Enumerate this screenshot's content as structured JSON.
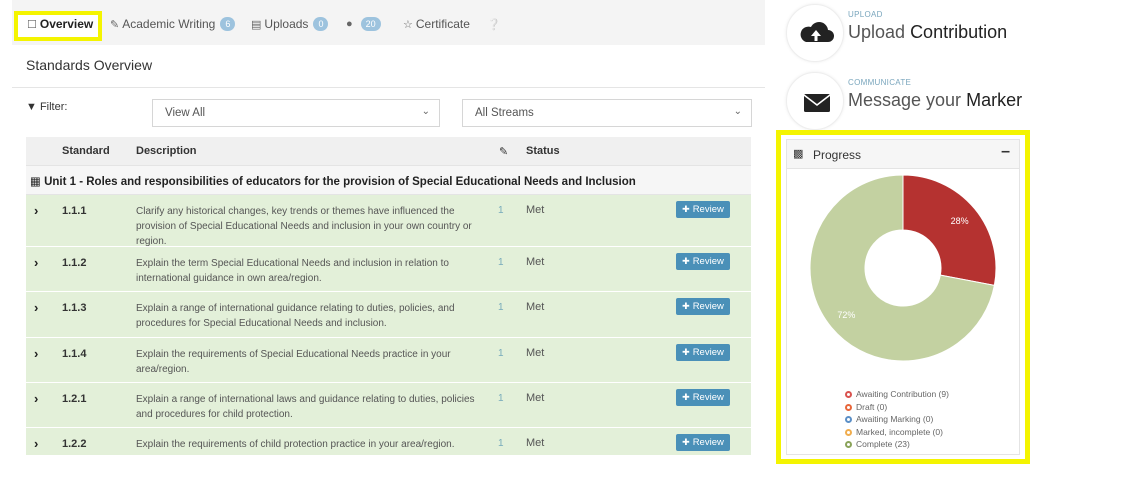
{
  "tabs": [
    {
      "label": "Overview",
      "icon": "bookmark-icon"
    },
    {
      "label": "Academic Writing",
      "icon": "pencil-icon",
      "badge": "6"
    },
    {
      "label": "Uploads",
      "icon": "file-icon",
      "badge": "0"
    },
    {
      "label": "",
      "icon": "comment-icon",
      "badge": "20"
    },
    {
      "label": "Certificate",
      "icon": "trophy-icon"
    },
    {
      "label": "",
      "icon": "help-icon"
    }
  ],
  "panel": {
    "title": "Standards Overview",
    "filter_label": "Filter:",
    "filter_value": "View All",
    "streams_value": "All Streams"
  },
  "table": {
    "headers": {
      "standard": "Standard",
      "description": "Description",
      "status": "Status"
    },
    "unit": "Unit 1 - Roles and responsibilities of educators for the provision of Special Educational Needs and Inclusion",
    "review_label": "Review",
    "rows": [
      {
        "standard": "1.1.1",
        "description": "Clarify any historical changes, key trends or themes have influenced the provision of Special Educational Needs and inclusion in your own country or region.",
        "count": "1",
        "status": "Met"
      },
      {
        "standard": "1.1.2",
        "description": "Explain the term Special Educational Needs and inclusion in relation to international guidance in own area/region.",
        "count": "1",
        "status": "Met"
      },
      {
        "standard": "1.1.3",
        "description": "Explain a range of international guidance relating to duties, policies, and procedures for Special Educational Needs and inclusion.",
        "count": "1",
        "status": "Met"
      },
      {
        "standard": "1.1.4",
        "description": "Explain the requirements of Special Educational Needs practice in your area/region.",
        "count": "1",
        "status": "Met"
      },
      {
        "standard": "1.2.1",
        "description": "Explain a range of international laws and guidance relating to duties, policies and procedures for child protection.",
        "count": "1",
        "status": "Met"
      },
      {
        "standard": "1.2.2",
        "description": "Explain the requirements of child protection practice in your area/region.",
        "count": "1",
        "status": "Met"
      }
    ]
  },
  "actions": {
    "upload": {
      "small": "UPLOAD",
      "text": "Upload",
      "bold": "Contribution"
    },
    "message": {
      "small": "COMMUNICATE",
      "text": "Message your",
      "bold": "Marker"
    }
  },
  "progress": {
    "title": "Progress",
    "colors": {
      "awaiting": "#b53230",
      "complete": "#c3d1a1"
    },
    "legend": [
      {
        "label": "Awaiting Contribution (9)",
        "color": "#d9534f"
      },
      {
        "label": "Draft (0)",
        "color": "#e8663a"
      },
      {
        "label": "Awaiting Marking (0)",
        "color": "#5b8fc7"
      },
      {
        "label": "Marked, incomplete (0)",
        "color": "#f0ad4e"
      },
      {
        "label": "Complete (23)",
        "color": "#8aa35a"
      }
    ]
  },
  "chart_data": {
    "type": "pie",
    "categories": [
      "Awaiting Contribution",
      "Complete"
    ],
    "values": [
      28,
      72
    ],
    "labels": [
      "28%",
      "72%"
    ]
  }
}
